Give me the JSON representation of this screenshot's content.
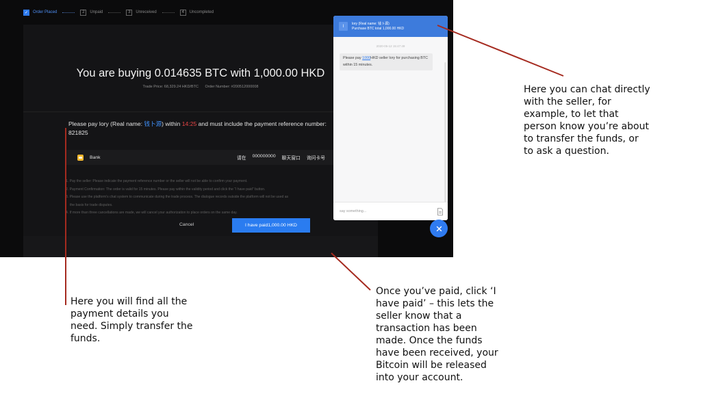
{
  "steps": [
    {
      "num": "✓",
      "label": "Order Placed",
      "active": true
    },
    {
      "num": "2",
      "label": "Unpaid"
    },
    {
      "num": "3",
      "label": "Unreceived"
    },
    {
      "num": "4",
      "label": "Uncompleted"
    }
  ],
  "order": {
    "headline": "You are buying 0.014635 BTC with 1,000.00 HKD",
    "trade_price": "Trade Price:  68,329.24 HKD/BTC",
    "order_number": "Order Number:  #200512000008"
  },
  "instruction": {
    "pre": "Please pay lory (Real name: ",
    "real_name": "钱卜源",
    "mid": ") within ",
    "timer": "14:25",
    "post": " and must include the payment reference number: 821825"
  },
  "payment": {
    "method": "Bank",
    "field1": "请在",
    "field2": "000000000",
    "field3": "聊天窗口",
    "field4": "询问卡号"
  },
  "notes": [
    "1. Pay the seller: Please indicate the payment reference number or the seller will not be able to confirm your payment.",
    "2. Payment Confirmation: The order is valid for 15 minutes. Please pay within the validity period and click the “I have paid” button.",
    "3. Please use the platform's chat system to communicate during the trade process. The dialogue records outside the platform will not be used as",
    "the basis for trade disputes.",
    "4. If more than three cancellations are made, we will cancel your authorization to place orders on the same day."
  ],
  "actions": {
    "cancel": "Cancel",
    "paid": "I have paid1,000.00 HKD"
  },
  "chat": {
    "avatar": "l",
    "header_name": "lory (Real name: 钱卜源)",
    "header_sub": "Purchase BTC total 1,000.00 HKD",
    "timestamp": "2020-05-12 15:47:49",
    "msg_pre": "Please pay ",
    "msg_link": "1000",
    "msg_post": "HKD seller lory for purchasing BTC within 15 minutes.",
    "placeholder": "say something..."
  },
  "annotations": {
    "chat": "Here you can chat directly with the seller, for example, to let that person know you’re about to transfer the funds, or to ask a question.",
    "payment": "Here you will find all the payment details you need. Simply transfer the funds.",
    "paid": "Once you’ve paid, click ‘I have paid’ – this lets the seller know that a transaction has been made. Once the funds have been received, your Bitcoin will be released into your account."
  },
  "colors": {
    "accent": "#2f7bf0",
    "timer": "#e84545",
    "annotation_line": "#a52a1f"
  }
}
